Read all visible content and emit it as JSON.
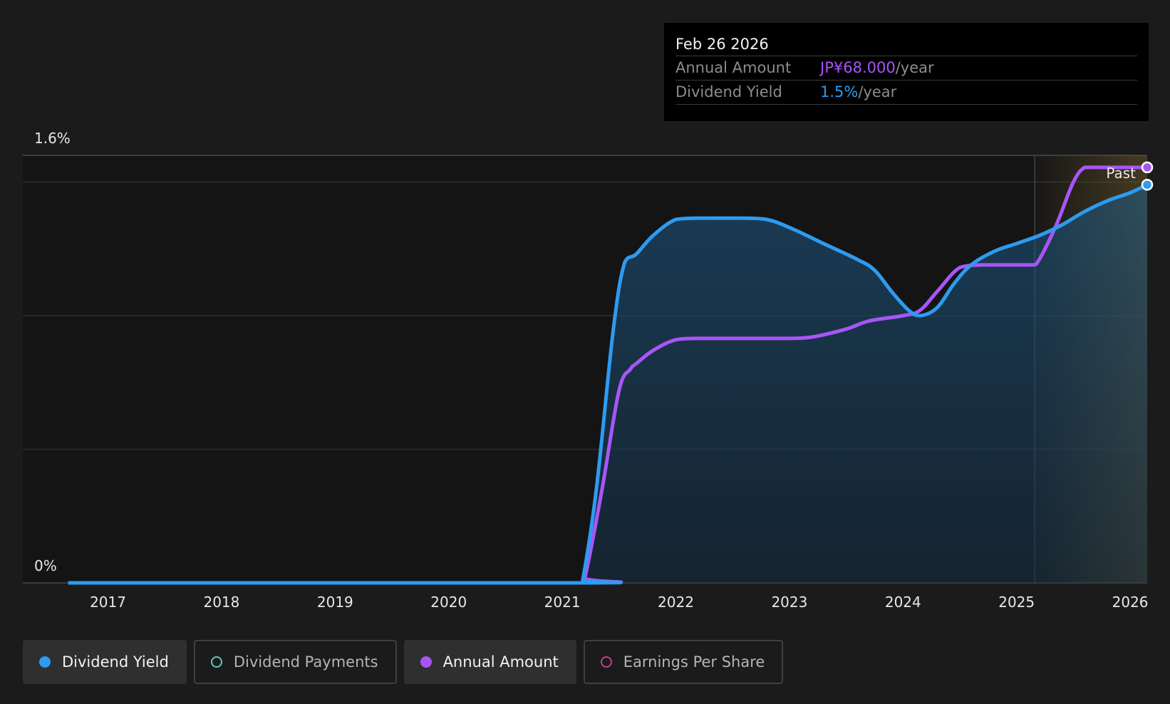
{
  "tooltip": {
    "date": "Feb 26 2026",
    "rows": [
      {
        "label": "Annual Amount",
        "value": "JP¥68.000",
        "unit": "/year",
        "color": "#a855f7"
      },
      {
        "label": "Dividend Yield",
        "value": "1.5%",
        "unit": "/year",
        "color": "#2d9bf0"
      }
    ]
  },
  "legend": [
    {
      "label": "Dividend Yield",
      "color": "#2d9bf0",
      "style": "filled",
      "active": true
    },
    {
      "label": "Dividend Payments",
      "color": "#5fc8b8",
      "style": "hollow",
      "active": false
    },
    {
      "label": "Annual Amount",
      "color": "#a855f7",
      "style": "filled",
      "active": true
    },
    {
      "label": "Earnings Per Share",
      "color": "#c2418a",
      "style": "hollow",
      "active": false
    }
  ],
  "chart_data": {
    "type": "line",
    "title": "",
    "xlabel": "",
    "ylabel": "",
    "x_ticks": [
      "2017",
      "2018",
      "2019",
      "2020",
      "2021",
      "2022",
      "2023",
      "2024",
      "2025",
      "2026"
    ],
    "y_tick_labels": [
      {
        "value": 1.6,
        "label": "1.6%"
      },
      {
        "value": 0,
        "label": "0%"
      }
    ],
    "ylim": [
      0,
      1.6
    ],
    "xlim": [
      2016.25,
      2026.15
    ],
    "grid": true,
    "past_marker": {
      "x": 2025.16,
      "label": "Past"
    },
    "series": [
      {
        "name": "Dividend Yield",
        "color": "#2d9bf0",
        "filled": true,
        "x": [
          2016.65,
          2021.15,
          2021.18,
          2021.3,
          2021.45,
          2021.55,
          2021.65,
          2021.8,
          2022.0,
          2022.2,
          2022.4,
          2022.6,
          2022.8,
          2023.0,
          2023.3,
          2023.6,
          2023.75,
          2023.9,
          2024.05,
          2024.15,
          2024.3,
          2024.45,
          2024.6,
          2024.8,
          2025.0,
          2025.2,
          2025.4,
          2025.6,
          2025.8,
          2026.0,
          2026.15
        ],
        "values": [
          0,
          0,
          0.01,
          0.35,
          0.95,
          1.2,
          1.23,
          1.3,
          1.36,
          1.365,
          1.365,
          1.365,
          1.36,
          1.33,
          1.27,
          1.21,
          1.17,
          1.09,
          1.02,
          1.0,
          1.03,
          1.12,
          1.19,
          1.24,
          1.27,
          1.3,
          1.34,
          1.39,
          1.43,
          1.46,
          1.49
        ]
      },
      {
        "name": "Annual Amount",
        "color": "#a855f7",
        "filled": false,
        "x": [
          2016.65,
          2021.15,
          2021.2,
          2021.35,
          2021.5,
          2021.6,
          2021.65,
          2021.8,
          2022.0,
          2022.2,
          2022.6,
          2023.0,
          2023.2,
          2023.5,
          2023.7,
          2024.0,
          2024.15,
          2024.3,
          2024.5,
          2024.7,
          2025.0,
          2025.15,
          2025.2,
          2025.35,
          2025.5,
          2025.6,
          2025.7,
          2025.9,
          2026.15
        ],
        "values": [
          0,
          0,
          0.02,
          0.35,
          0.72,
          0.8,
          0.82,
          0.87,
          0.91,
          0.915,
          0.915,
          0.915,
          0.92,
          0.95,
          0.98,
          1.0,
          1.02,
          1.09,
          1.18,
          1.19,
          1.19,
          1.19,
          1.21,
          1.34,
          1.5,
          1.555,
          1.555,
          1.555,
          1.555
        ]
      }
    ]
  }
}
